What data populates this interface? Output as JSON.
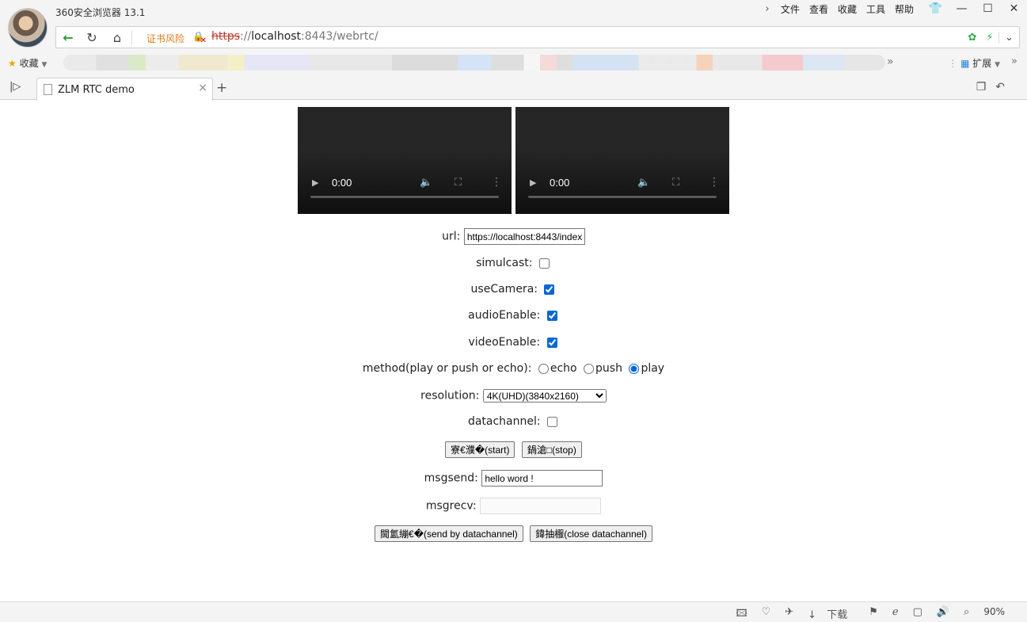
{
  "window": {
    "title": "360安全浏览器 13.1",
    "menu": [
      "文件",
      "查看",
      "收藏",
      "工具",
      "帮助"
    ]
  },
  "address": {
    "cert_warning": "证书风险",
    "url_protocol": "https",
    "url_sep": "://",
    "url_host": "localhost",
    "url_rest": ":8443/webrtc/"
  },
  "bookmarks": {
    "favorites_label": "收藏",
    "extensions_label": "扩展"
  },
  "tabs": [
    {
      "label": "ZLM RTC demo",
      "active": true
    }
  ],
  "page": {
    "videos": [
      {
        "time": "0:00"
      },
      {
        "time": "0:00"
      }
    ],
    "url_label": "url:",
    "url_value": "https://localhost:8443/index",
    "simulcast_label": "simulcast:",
    "simulcast_checked": false,
    "use_camera_label": "useCamera:",
    "use_camera_checked": true,
    "audio_enable_label": "audioEnable:",
    "audio_enable_checked": true,
    "video_enable_label": "videoEnable:",
    "video_enable_checked": true,
    "method_label": "method(play or push or echo):",
    "methods": [
      {
        "label": "echo",
        "checked": false
      },
      {
        "label": "push",
        "checked": false
      },
      {
        "label": "play",
        "checked": true
      }
    ],
    "resolution_label": "resolution:",
    "resolution_value": "4K(UHD)(3840x2160)",
    "datachannel_label": "datachannel:",
    "datachannel_checked": false,
    "start_button": "寮€濮�(start)",
    "stop_button": "鍋滄□(stop)",
    "msgsend_label": "msgsend:",
    "msgsend_value": "hello word !",
    "msgrecv_label": "msgrecv:",
    "msgrecv_value": "",
    "send_button": "閫氳繃€�(send by datachannel)",
    "close_button": "鍏抽棴(close datachannel)"
  },
  "statusbar": {
    "download_label": "下载",
    "zoom": "90%"
  }
}
